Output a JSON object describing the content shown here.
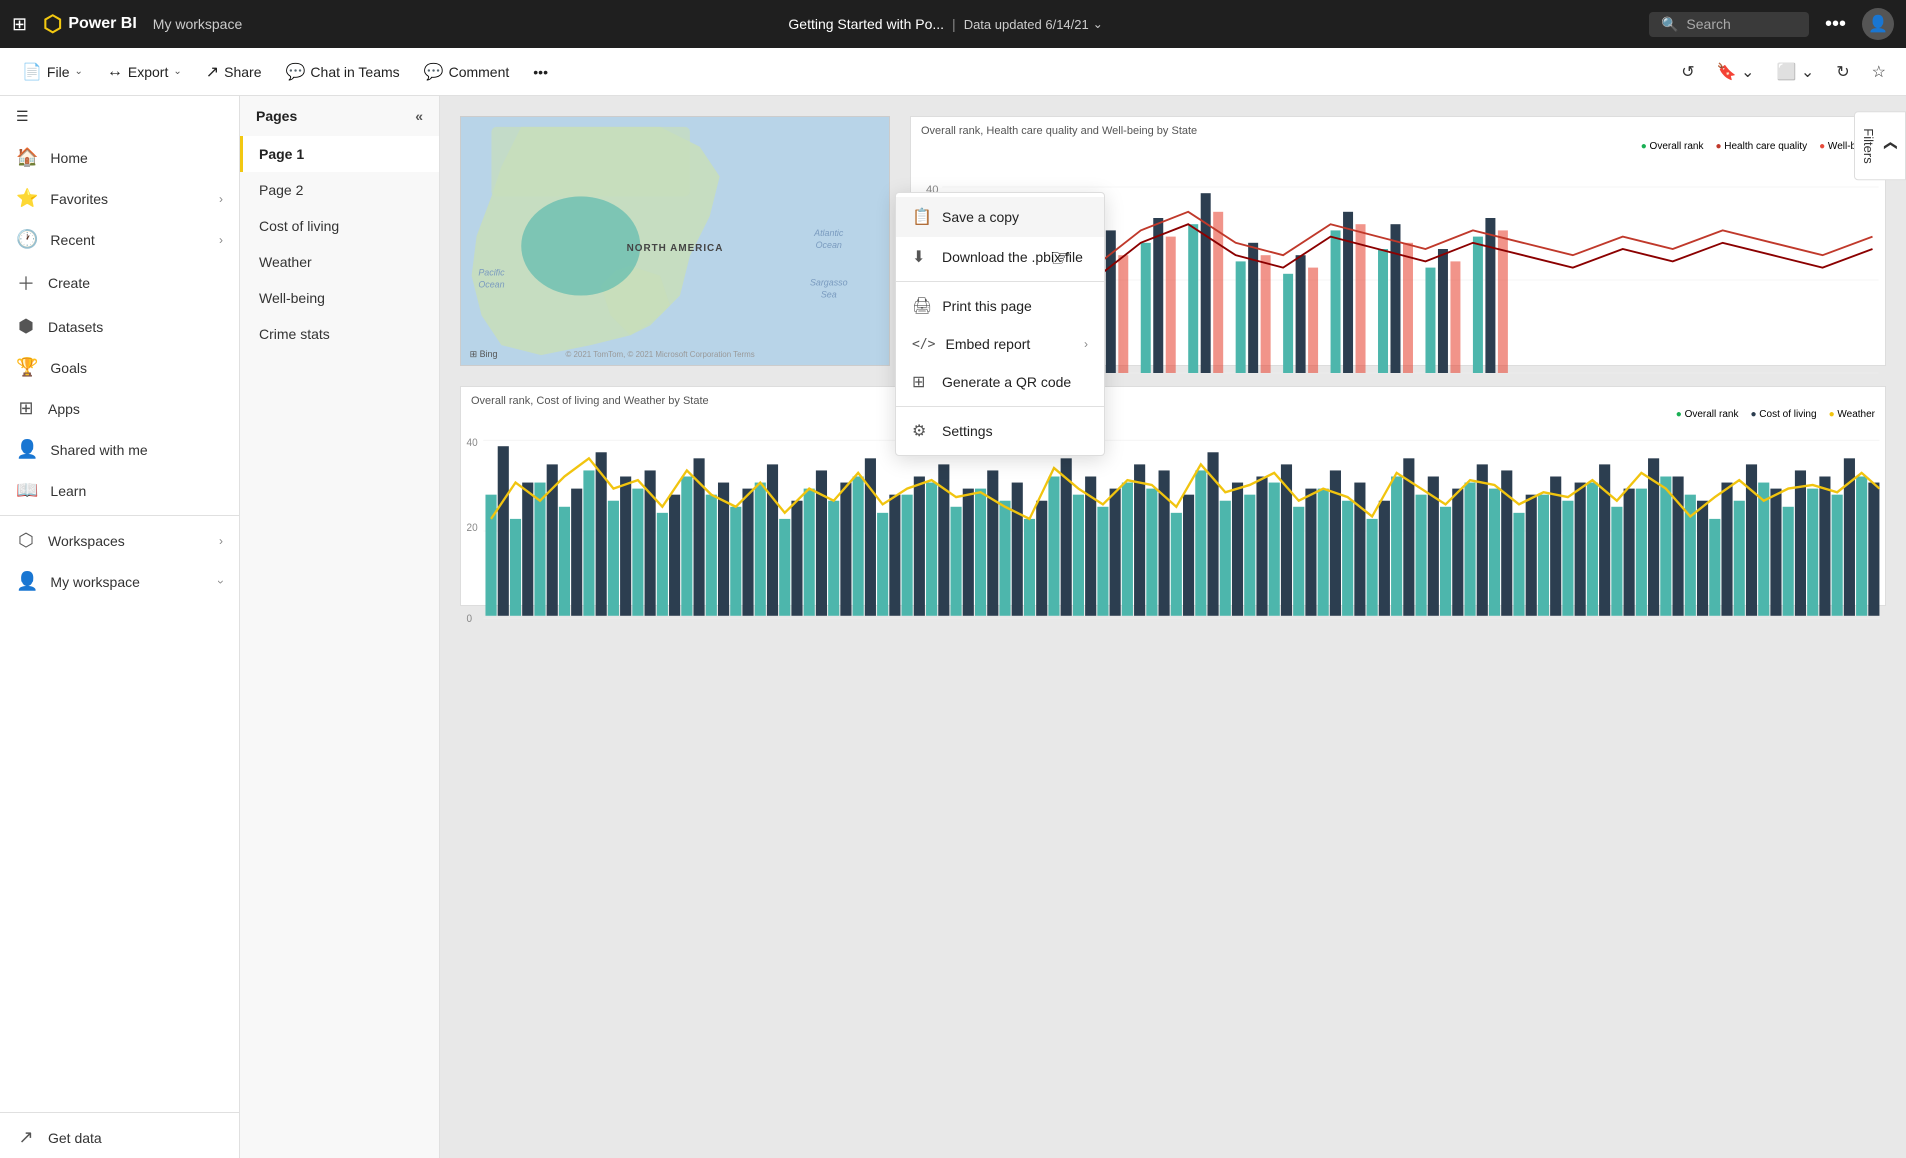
{
  "topbar": {
    "grid_icon": "⊞",
    "logo": "Power BI",
    "logo_color": "#f2c811",
    "workspace": "My workspace",
    "title": "Getting Started with Po...",
    "separator": "|",
    "updated": "Data updated 6/14/21",
    "chevron": "⌄",
    "search_placeholder": "Search",
    "more_icon": "•••",
    "avatar_icon": "👤"
  },
  "toolbar": {
    "file_label": "File",
    "export_label": "Export",
    "share_label": "Share",
    "chat_label": "Chat in Teams",
    "comment_label": "Comment",
    "more_icon": "•••",
    "undo_icon": "↺",
    "bookmark_icon": "🔖",
    "fit_icon": "⬜",
    "refresh_icon": "↻",
    "star_icon": "☆",
    "chevron": "⌄"
  },
  "sidebar": {
    "collapse_icon": "☰",
    "items": [
      {
        "label": "Home",
        "icon": "🏠"
      },
      {
        "label": "Favorites",
        "icon": "⭐",
        "has_chevron": true
      },
      {
        "label": "Recent",
        "icon": "🕐",
        "has_chevron": true
      },
      {
        "label": "Create",
        "icon": "＋"
      },
      {
        "label": "Datasets",
        "icon": "⬢"
      },
      {
        "label": "Goals",
        "icon": "🏆"
      },
      {
        "label": "Apps",
        "icon": "⊞"
      },
      {
        "label": "Shared with me",
        "icon": "👤"
      },
      {
        "label": "Learn",
        "icon": "📖"
      },
      {
        "label": "Workspaces",
        "icon": "⬡",
        "has_chevron": true
      },
      {
        "label": "My workspace",
        "icon": "👤",
        "has_chevron": true
      }
    ],
    "bottom_item": {
      "label": "Get data",
      "icon": "↗"
    }
  },
  "pages": {
    "title": "Pages",
    "collapse_icon": "«",
    "items": [
      {
        "label": "Page 1",
        "active": true
      },
      {
        "label": "Page 2",
        "active": false
      },
      {
        "label": "Cost of living",
        "active": false
      },
      {
        "label": "Weather",
        "active": false
      },
      {
        "label": "Well-being",
        "active": false
      },
      {
        "label": "Crime stats",
        "active": false
      }
    ]
  },
  "dropdown": {
    "items": [
      {
        "label": "Save a copy",
        "icon": "📋",
        "has_sub": false
      },
      {
        "label": "Download the .pbix file",
        "icon": "⬇",
        "has_sub": false
      },
      {
        "label": "Print this page",
        "icon": "🖨",
        "has_sub": false
      },
      {
        "label": "Embed report",
        "icon": "</>",
        "has_sub": true
      },
      {
        "label": "Generate a QR code",
        "icon": "⊞",
        "has_sub": false
      },
      {
        "label": "Settings",
        "icon": "⚙",
        "has_sub": false
      }
    ]
  },
  "charts": {
    "chart1_title": "Overall rank, Health care quality and Well-being by State",
    "chart2_title": "Overall rank, Cost of living and Weather by State",
    "legend1": [
      {
        "label": "Overall rank",
        "color": "#1aaf54"
      },
      {
        "label": "Health care quality",
        "color": "#c0392b"
      },
      {
        "label": "Well-being",
        "color": "#e74c3c"
      }
    ],
    "legend2": [
      {
        "label": "Overall rank",
        "color": "#1aaf54"
      },
      {
        "label": "Cost of living",
        "color": "#2c3e50"
      },
      {
        "label": "Weather",
        "color": "#f1c40f"
      }
    ]
  },
  "filter_panel": {
    "label": "Filters",
    "arrow_icon": "❮"
  },
  "map": {
    "continent_label": "NORTH AMERICA",
    "ocean1": "Pacific\nOcean",
    "ocean2": "Atlantic\nOcean",
    "ocean3": "Sargasso\nSea",
    "bing": "⊞ Bing",
    "copyright": "© 2021 TomTom, © 2021 Microsoft Corporation Terms"
  }
}
